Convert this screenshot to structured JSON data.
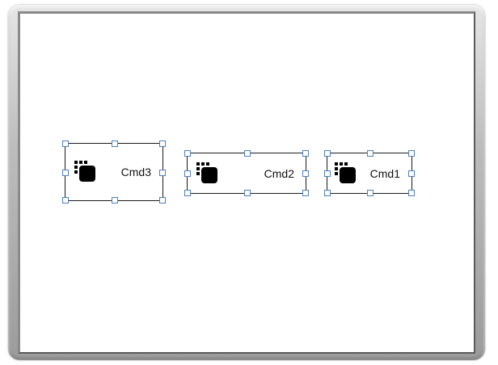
{
  "canvas": {
    "buttons": [
      {
        "label": "Cmd3",
        "icon": "command-button-icon"
      },
      {
        "label": "Cmd2",
        "icon": "command-button-icon"
      },
      {
        "label": "Cmd1",
        "icon": "command-button-icon"
      }
    ]
  },
  "colors": {
    "selection_handle": "#4f7fc4",
    "button_border": "#1a1a1a",
    "canvas_background": "#ffffff"
  }
}
